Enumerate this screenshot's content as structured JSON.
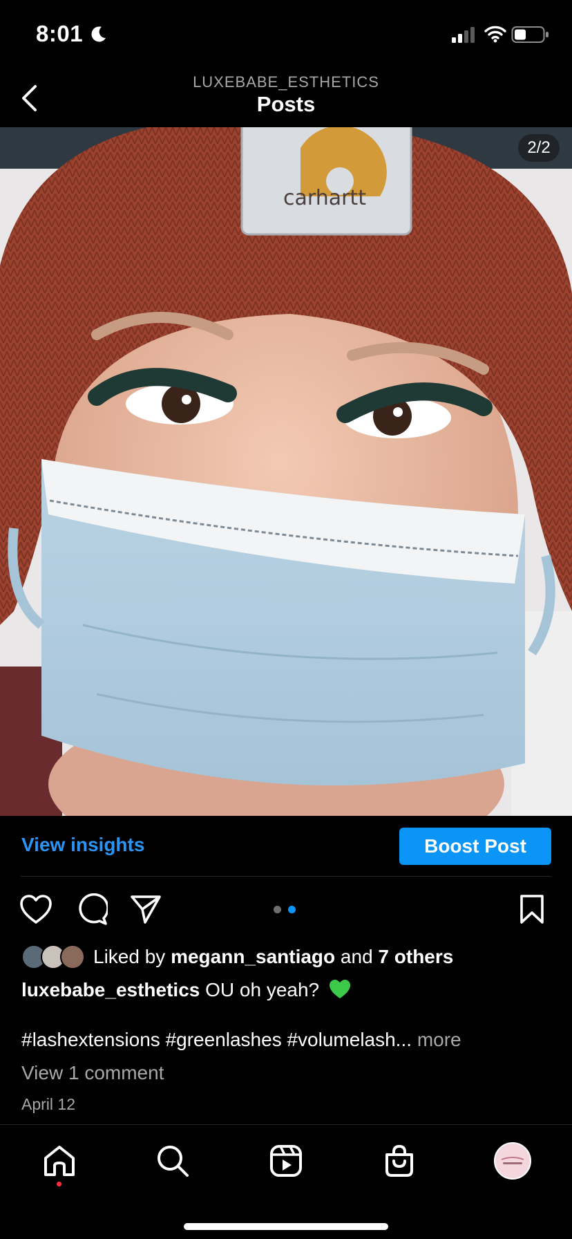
{
  "status_bar": {
    "time": "8:01",
    "icons": [
      "moon-icon",
      "signal-icon",
      "wifi-icon",
      "battery-icon"
    ]
  },
  "header": {
    "account": "LUXEBABE_ESTHETICS",
    "title": "Posts",
    "back_icon": "chevron-left-icon"
  },
  "post": {
    "counter": "2/2",
    "image_text": "carhartt",
    "view_insights": "View insights",
    "boost_post": "Boost Post",
    "likes": {
      "prefix": "Liked by",
      "user": "megann_santiago",
      "and": "and",
      "others": "7 others"
    },
    "caption": {
      "username": "luxebabe_esthetics",
      "text": "OU oh yeah?"
    },
    "hashtags": "#lashextensions #greenlashes #volumelash...",
    "more": "more",
    "view_comments": "View 1 comment",
    "date": "April 12",
    "carousel": {
      "count": 2,
      "active_index": 1
    }
  },
  "bottom_nav": {
    "items": [
      "home-icon",
      "search-icon",
      "reels-icon",
      "shop-icon",
      "profile-avatar"
    ],
    "active": "home"
  },
  "colors": {
    "accent_blue": "#0b95f6",
    "link_blue": "#2a95f5",
    "muted": "#a8a8a8",
    "heart_green": "#3cc94a",
    "notification": "#ff3040"
  }
}
